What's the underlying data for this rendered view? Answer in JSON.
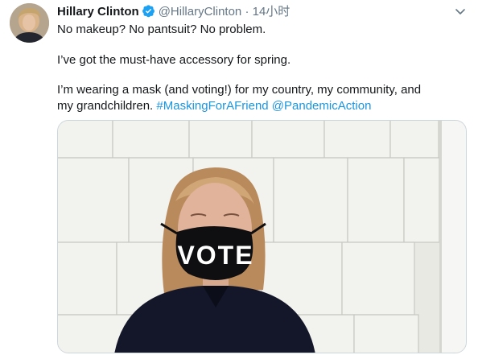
{
  "author": {
    "name": "Hillary Clinton",
    "handle": "@HillaryClinton",
    "separator": "·",
    "time": "14小时"
  },
  "icons": {
    "verified": "verified-badge-icon",
    "more": "chevron-down-icon",
    "verified_color": "#1da1f2"
  },
  "tweet": {
    "line1": "No makeup? No pantsuit? No problem.",
    "line2": "I’ve got the must-have accessory for spring.",
    "line3": "I’m wearing a mask (and voting!) for my country, my community, and",
    "line4_prefix": "my grandchildren.",
    "hashtag": "#MaskingForAFriend",
    "mention": "@PandemicAction"
  },
  "media": {
    "mask_text": "VOTE"
  },
  "colors": {
    "link": "#1b95e0",
    "muted": "#657786"
  }
}
